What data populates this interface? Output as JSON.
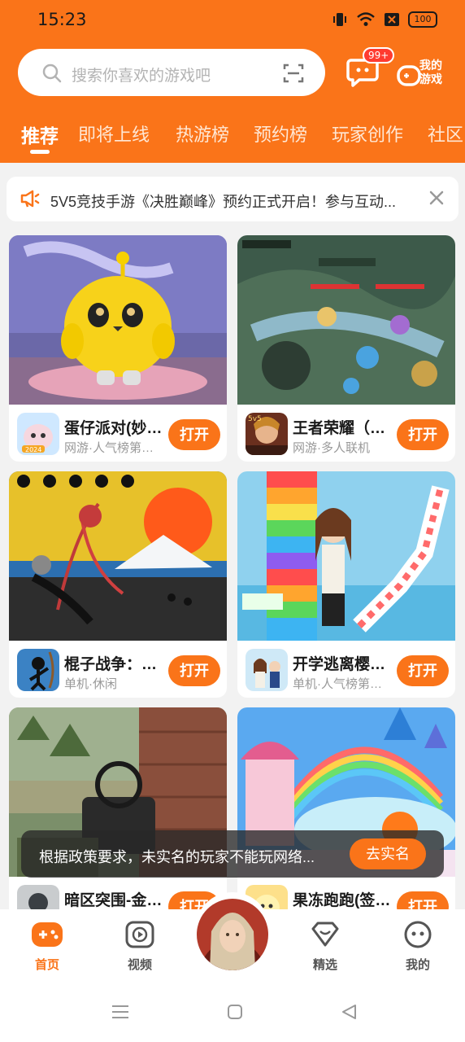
{
  "status": {
    "time": "15:23",
    "battery": "100"
  },
  "search": {
    "placeholder": "搜索你喜欢的游戏吧",
    "icon": "search-icon",
    "scan_icon": "scan-icon"
  },
  "header": {
    "message_badge": "99+",
    "my_games_line1": "我的",
    "my_games_line2": "游戏"
  },
  "tabs": [
    {
      "label": "推荐",
      "active": true
    },
    {
      "label": "即将上线"
    },
    {
      "label": "热游榜"
    },
    {
      "label": "预约榜"
    },
    {
      "label": "玩家创作"
    },
    {
      "label": "社区"
    }
  ],
  "notice": {
    "text": "5V5竞技手游《决胜巅峰》预约正式开启！参与互动..."
  },
  "games": [
    {
      "name": "蛋仔派对(妙…",
      "meta": "网游·人气榜第…",
      "button": "打开"
    },
    {
      "name": "王者荣耀（…",
      "meta": "网游·多人联机",
      "button": "打开"
    },
    {
      "name": "棍子战争：…",
      "meta": "单机·休闲",
      "button": "打开"
    },
    {
      "name": "开学逃离樱…",
      "meta": "单机·人气榜第…",
      "button": "打开"
    },
    {
      "name": "暗区突围-金…",
      "meta": "",
      "button": "打开"
    },
    {
      "name": "果冻跑跑(签…",
      "meta": "",
      "button": "打开"
    }
  ],
  "toast": {
    "text": "根据政策要求，未实名的玩家不能玩网络...",
    "button": "去实名"
  },
  "bottom_nav": [
    {
      "label": "首页",
      "icon": "gamepad-icon",
      "active": true
    },
    {
      "label": "视频",
      "icon": "video-icon"
    },
    {
      "label": "精选",
      "icon": "heart-icon"
    },
    {
      "label": "我的",
      "icon": "face-icon"
    }
  ],
  "colors": {
    "brand": "#fa7419",
    "badge": "#ff3b30"
  }
}
